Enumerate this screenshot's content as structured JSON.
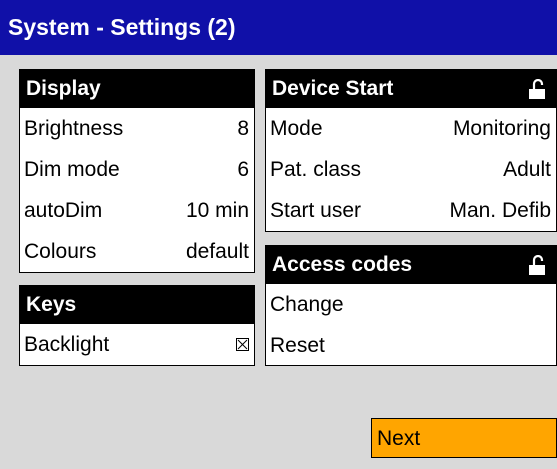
{
  "title": "System - Settings (2)",
  "display": {
    "header": "Display",
    "rows": [
      {
        "label": "Brightness",
        "value": "8"
      },
      {
        "label": "Dim mode",
        "value": "6"
      },
      {
        "label": "autoDim",
        "value": "10 min"
      },
      {
        "label": "Colours",
        "value": "default"
      }
    ]
  },
  "keys": {
    "header": "Keys",
    "backlight_label": "Backlight",
    "backlight_checked": true
  },
  "device_start": {
    "header": "Device Start",
    "header_icon": "unlock-icon",
    "rows": [
      {
        "label": "Mode",
        "value": "Monitoring"
      },
      {
        "label": "Pat. class",
        "value": "Adult"
      },
      {
        "label": "Start user",
        "value": "Man. Defib"
      }
    ]
  },
  "access_codes": {
    "header": "Access codes",
    "header_icon": "unlock-icon",
    "change_label": "Change",
    "reset_label": "Reset"
  },
  "next_label": "Next",
  "colors": {
    "titlebar": "#1010a8",
    "background": "#d9d9d9",
    "next_button": "#ffa500"
  }
}
